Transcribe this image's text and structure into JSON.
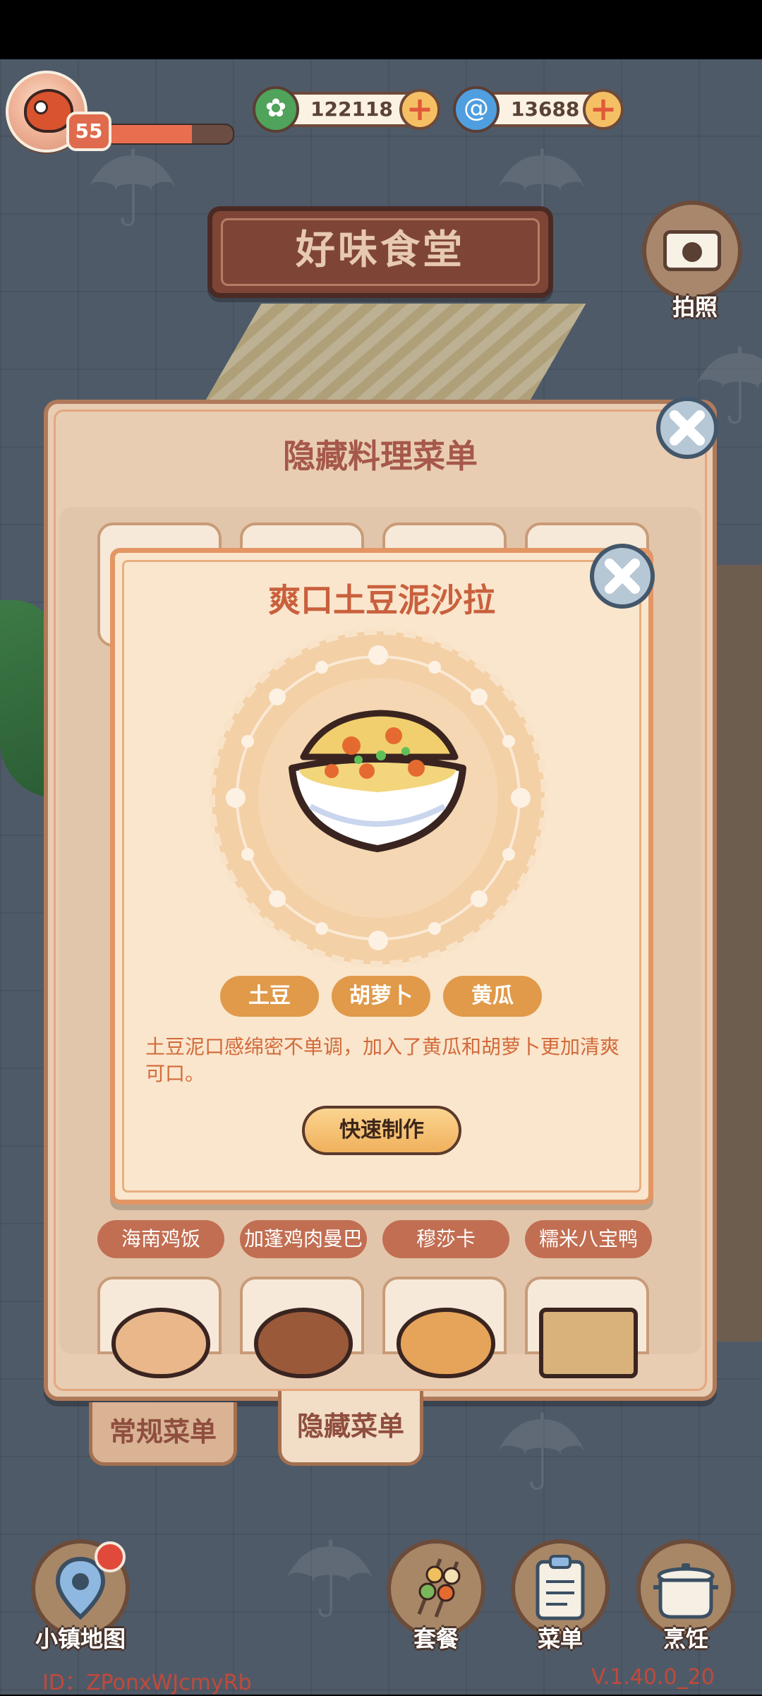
{
  "player": {
    "level": "55",
    "xp_fraction": 0.68
  },
  "currencies": [
    {
      "name": "clover-coin",
      "value": "122118",
      "color": "#4fa35a"
    },
    {
      "name": "swirl-gem",
      "value": "13688",
      "color": "#4f9ee0"
    }
  ],
  "camera": {
    "label": "拍照"
  },
  "restaurant": {
    "name": "好味食堂"
  },
  "hidden_menu_panel": {
    "title": "隐藏料理菜单",
    "visible_labels": [
      "海南鸡饭",
      "加蓬鸡肉曼巴",
      "穆莎卡",
      "糯米八宝鸭"
    ]
  },
  "tabs": {
    "regular": "常规菜单",
    "hidden": "隐藏菜单"
  },
  "recipe_popup": {
    "title": "爽口土豆泥沙拉",
    "ingredients": [
      "土豆",
      "胡萝卜",
      "黄瓜"
    ],
    "description": "土豆泥口感绵密不单调，加入了黄瓜和胡萝卜更加清爽可口。",
    "button": "快速制作"
  },
  "bottom_nav": {
    "map": "小镇地图",
    "combo": "套餐",
    "menu": "菜单",
    "cook": "烹饪"
  },
  "footer": {
    "user_id": "ID：ZPonxWJcmyRb",
    "version": "V.1.40.0_20"
  },
  "colors": {
    "accent_orange": "#e09a4a",
    "title_red": "#c9603d",
    "panel_cream": "#fae6cd",
    "label_brown": "#c26e52"
  }
}
